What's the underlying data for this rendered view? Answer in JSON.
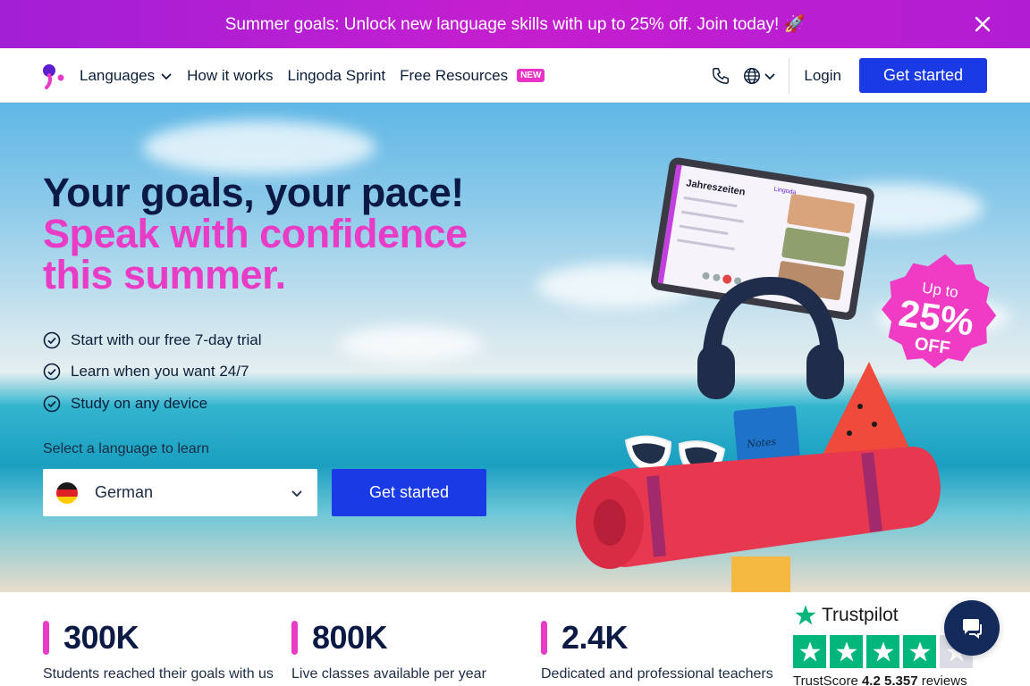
{
  "promo": {
    "text": "Summer goals: Unlock new language skills with up to 25% off. Join today! 🚀",
    "close_icon": "close-icon"
  },
  "nav": {
    "links": [
      {
        "label": "Languages",
        "has_dropdown": true
      },
      {
        "label": "How it works"
      },
      {
        "label": "Lingoda Sprint"
      },
      {
        "label": "Free Resources",
        "badge": "NEW"
      }
    ],
    "login": "Login",
    "cta": "Get started",
    "icons": [
      "phone-icon",
      "globe-icon",
      "chevron-down-icon"
    ]
  },
  "hero": {
    "headline_line1": "Your goals, your pace!",
    "headline_line2": "Speak with confidence this summer.",
    "features": [
      "Start with our free 7-day trial",
      "Learn when you want 24/7",
      "Study on any device"
    ],
    "select_label": "Select a language to learn",
    "selected_language": "German",
    "cta": "Get started",
    "promo_badge": {
      "line1": "Up to",
      "line2": "25%",
      "line3": "OFF"
    },
    "tablet": {
      "title": "Jahreszeiten",
      "brand": "Lingoda"
    },
    "notebook_label": "Notes"
  },
  "stats": [
    {
      "value": "300K",
      "desc": "Students reached their goals with us"
    },
    {
      "value": "800K",
      "desc": "Live classes available per year"
    },
    {
      "value": "2.4K",
      "desc": "Dedicated and professional teachers"
    }
  ],
  "trustpilot": {
    "brand": "Trustpilot",
    "score_label": "TrustScore",
    "score": "4.2",
    "reviews_count": "5.357",
    "reviews_label": "reviews",
    "rating": 4,
    "max_rating": 5
  },
  "colors": {
    "brand_blue": "#1a3ae6",
    "accent_pink": "#e93cc6",
    "promo_purple": "#b21dd3",
    "trustpilot_green": "#00b67a"
  }
}
